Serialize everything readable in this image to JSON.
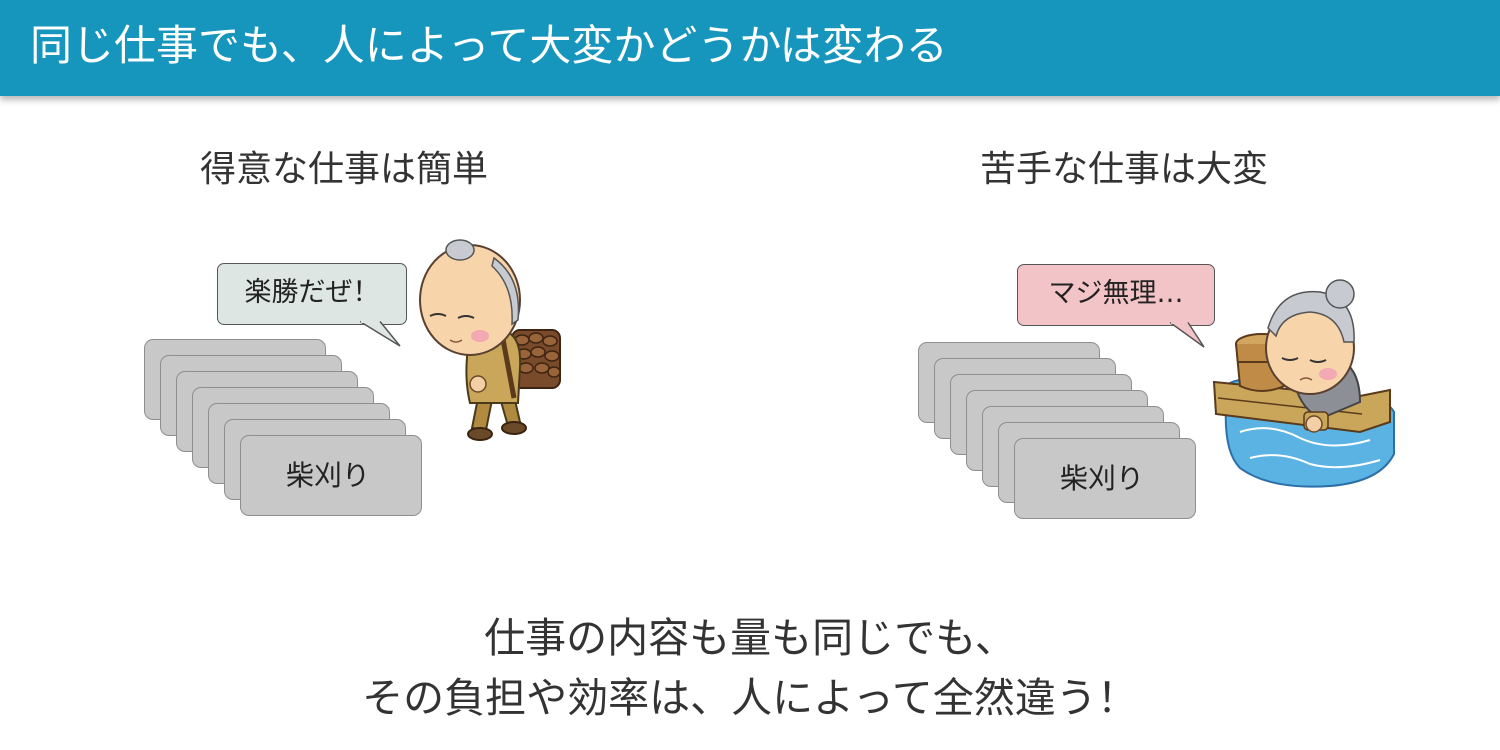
{
  "header": {
    "title": "同じ仕事でも、人によって大変かどうかは変わる"
  },
  "left": {
    "subtitle": "得意な仕事は簡単",
    "speech": "楽勝だぜ！",
    "card_label": "柴刈り"
  },
  "right": {
    "subtitle": "苦手な仕事は大変",
    "speech": "マジ無理…",
    "card_label": "柴刈り"
  },
  "footer": {
    "line1": "仕事の内容も量も同じでも、",
    "line2": "その負担や効率は、人によって全然違う！"
  },
  "colors": {
    "header_bg": "#1796bd",
    "bubble_left": "#dde6e3",
    "bubble_right": "#f2c4c7",
    "card_fill": "#c8c8c8"
  }
}
